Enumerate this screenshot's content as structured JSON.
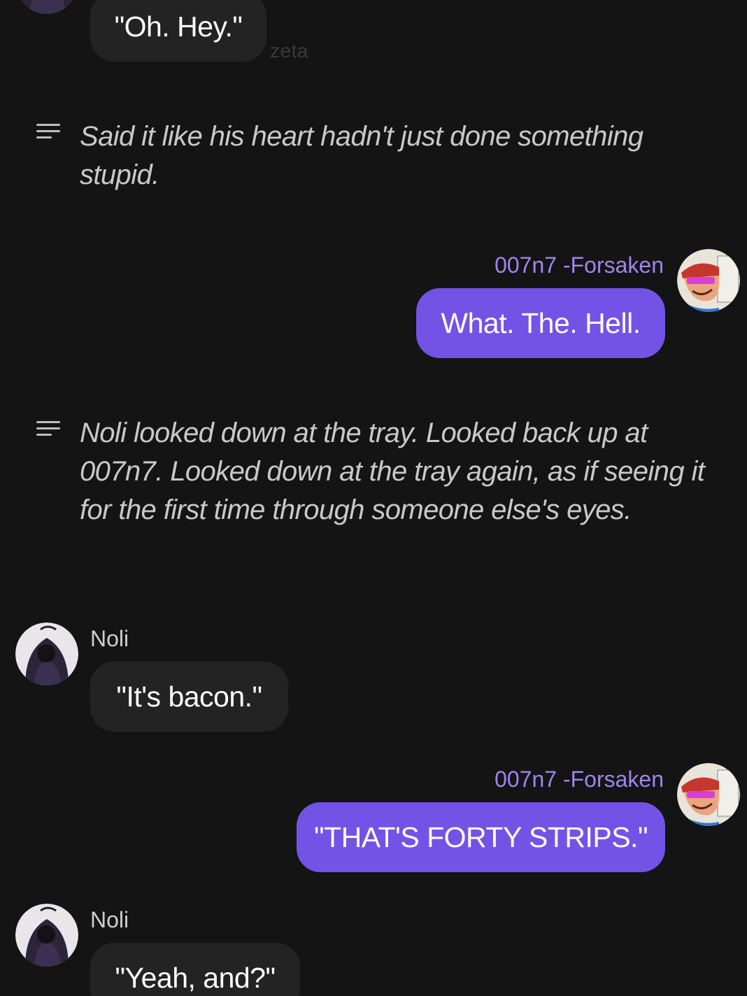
{
  "messages": [
    {
      "sender": "",
      "text": "\"Oh. Hey.\"",
      "watermark": "zeta"
    },
    {
      "narration": "Said it like his heart hadn't just done something stupid."
    },
    {
      "sender": "007n7 -Forsaken",
      "text": "What. The. Hell."
    },
    {
      "narration": "Noli looked down at the tray. Looked back up at 007n7. Looked down at the tray again, as if seeing it for the first time through someone else's eyes."
    },
    {
      "sender": "Noli",
      "text": "\"It's bacon.\""
    },
    {
      "sender": "007n7 -Forsaken",
      "text": "\"THAT'S FORTY STRIPS.\""
    },
    {
      "sender": "Noli",
      "text": "\"Yeah, and?\""
    }
  ],
  "colors": {
    "background": "#141414",
    "user_bubble": "#7253e6",
    "bot_bubble": "#232323",
    "user_name": "#9c86f0"
  },
  "icons": {
    "narration": "narration-lines-icon"
  }
}
